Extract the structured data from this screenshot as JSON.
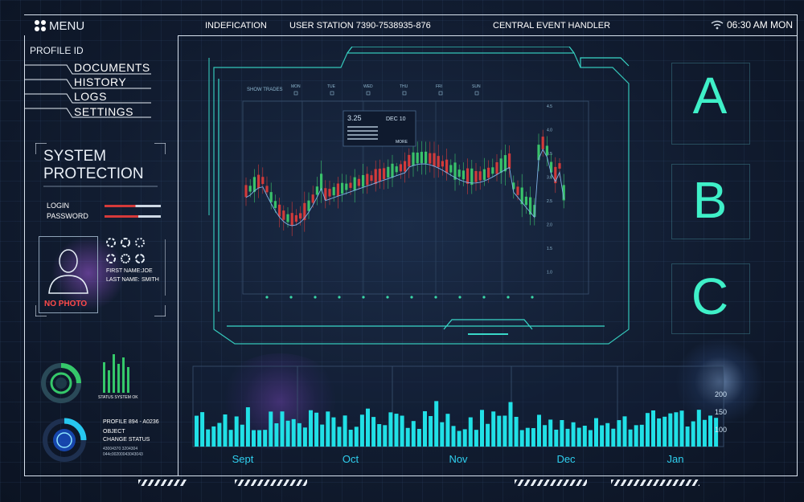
{
  "header": {
    "menu_label": "MENU",
    "menu_icon": "grid-dots-icon",
    "identification": "INDEFICATION",
    "user_station": "USER  STATION 7390-7538935-876",
    "central_event": "CENTRAL EVENT HANDLER",
    "time": "06:30 AM MON",
    "wifi_icon": "wifi-icon"
  },
  "sidebar": {
    "profile_id": "PROFILE  ID",
    "items": [
      {
        "label": "DOCUMENTS"
      },
      {
        "label": "HISTORY"
      },
      {
        "label": "LOGS"
      },
      {
        "label": "SETTINGS"
      }
    ]
  },
  "protection": {
    "title_line1": "SYSTEM",
    "title_line2": "PROTECTION",
    "login_label": "LOGIN",
    "password_label": "PASSWORD",
    "first_name_label": "FIRST NAME:",
    "first_name": "JOE",
    "last_name_label": "LAST NAME:",
    "last_name": "SMITH",
    "no_photo": "NO PHOTO"
  },
  "status": {
    "status_label": "STATUS SYSTEM OK",
    "profile_line": "PROFILE 894 - A0236",
    "object_line": "OBJECT",
    "change_status": "CHANGE STATUS",
    "code_line1": "43004370  3204304",
    "code_line2": "044c00200043043043"
  },
  "trading": {
    "show_trades": "SHOW TRADES",
    "days": [
      "MON",
      "TUE",
      "WED",
      "THU",
      "FRI",
      "SUN"
    ],
    "tooltip_value": "3.25",
    "tooltip_date": "DEC 10",
    "tooltip_more": "MORE",
    "y_ticks": [
      "4.5",
      "4.0",
      "3.5",
      "3.0",
      "2.5",
      "2.0",
      "1.5",
      "1.0"
    ]
  },
  "letters": [
    "A",
    "B",
    "C"
  ],
  "volume": {
    "y_ticks": [
      "200",
      "150",
      "100"
    ],
    "months": [
      "Sept",
      "Oct",
      "Nov",
      "Dec",
      "Jan"
    ]
  },
  "colors": {
    "accent": "#3ff0c8",
    "cyan_bar": "#21e0e6",
    "candle_up": "#39c26a",
    "candle_down": "#d23a3a",
    "frame": "#39d8c8"
  }
}
